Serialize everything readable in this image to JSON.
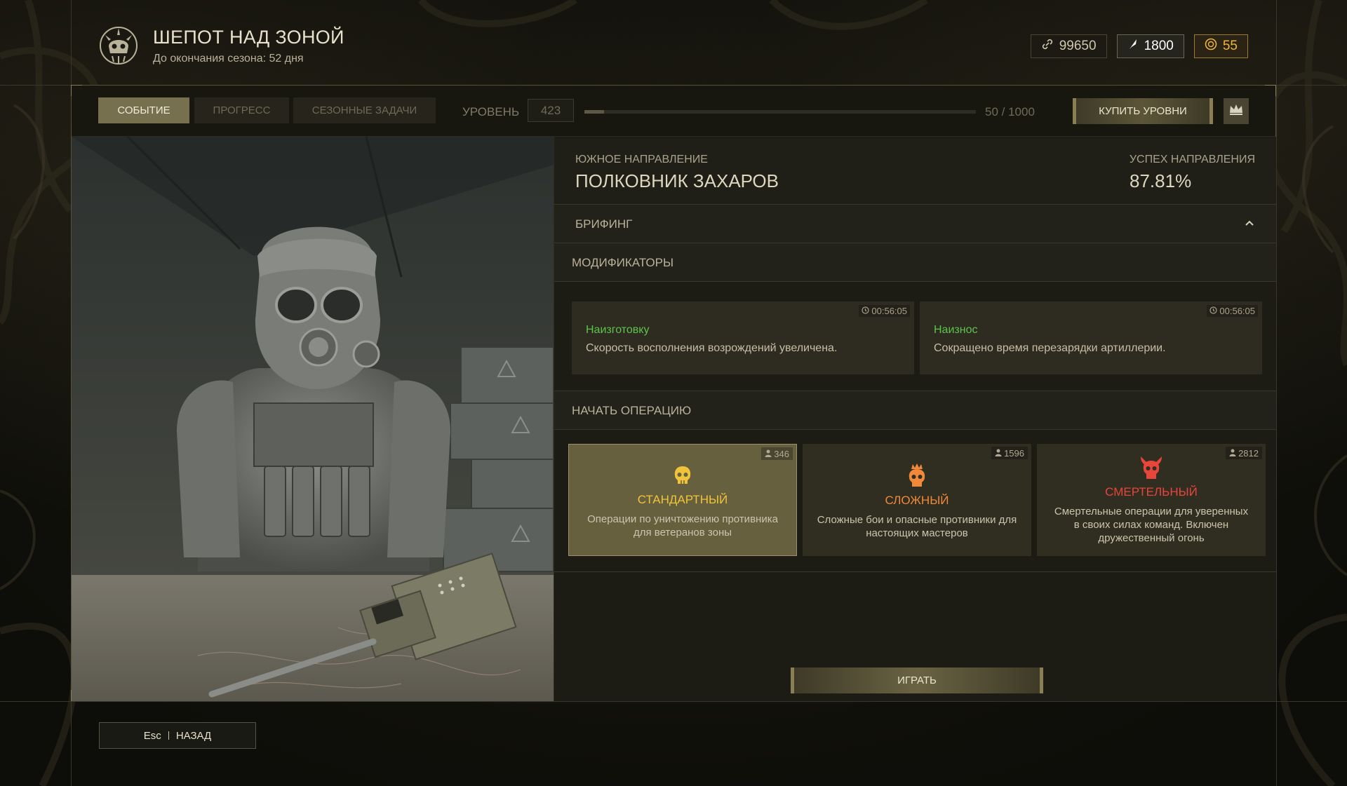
{
  "header": {
    "title": "ШЕПОТ НАД ЗОНОЙ",
    "subtitle": "До окончания сезона: 52 дня",
    "logo_icon": "skull-emblem-icon"
  },
  "currencies": [
    {
      "icon": "link-icon",
      "value": "99650"
    },
    {
      "icon": "feather-icon",
      "value": "1800"
    },
    {
      "icon": "coin-icon",
      "value": "55"
    }
  ],
  "tabs": [
    {
      "label": "СОБЫТИЕ",
      "active": true
    },
    {
      "label": "ПРОГРЕСС",
      "active": false
    },
    {
      "label": "СЕЗОННЫЕ ЗАДАЧИ",
      "active": false
    }
  ],
  "level": {
    "label": "УРОВЕНЬ",
    "value": "423",
    "progress_text": "50 / 1000",
    "progress_fraction": 0.05,
    "buy_label": "КУПИТЬ УРОВНИ",
    "crown_icon": "crown-icon"
  },
  "direction": {
    "subtitle": "ЮЖНОЕ НАПРАВЛЕНИЕ",
    "name": "ПОЛКОВНИК ЗАХАРОВ",
    "success_label": "УСПЕХ НАПРАВЛЕНИЯ",
    "success_value": "87.81%"
  },
  "briefing": {
    "label": "БРИФИНГ",
    "icon": "chevron-up-icon"
  },
  "modifiers": {
    "label": "МОДИФИКАТОРЫ",
    "items": [
      {
        "timer": "00:56:05",
        "name": "Наизготовку",
        "desc": "Скорость восполнения возрождений увеличена."
      },
      {
        "timer": "00:56:05",
        "name": "Наизнос",
        "desc": "Сокращено время перезарядки артиллерии."
      }
    ]
  },
  "operation": {
    "label": "НАЧАТЬ ОПЕРАЦИЮ",
    "modes": [
      {
        "count": "346",
        "name": "СТАНДАРТНЫЙ",
        "desc": "Операции по уничтожению противника для ветеранов зоны",
        "color": "#f0c43a",
        "icon": "skull-icon",
        "selected": true
      },
      {
        "count": "1596",
        "name": "СЛОЖНЫЙ",
        "desc": "Сложные бои и опасные противники для настоящих мастеров",
        "color": "#f08a3a",
        "icon": "crowned-skull-icon",
        "selected": false
      },
      {
        "count": "2812",
        "name": "СМЕРТЕЛЬНЫЙ",
        "desc": "Смертельные операции для уверенных в своих силах команд. Включен дружественный огонь",
        "color": "#e8453c",
        "icon": "horned-skull-icon",
        "selected": false
      }
    ],
    "play_label": "ИГРАТЬ"
  },
  "footer": {
    "key": "Esc",
    "back_label": "НАЗАД"
  }
}
